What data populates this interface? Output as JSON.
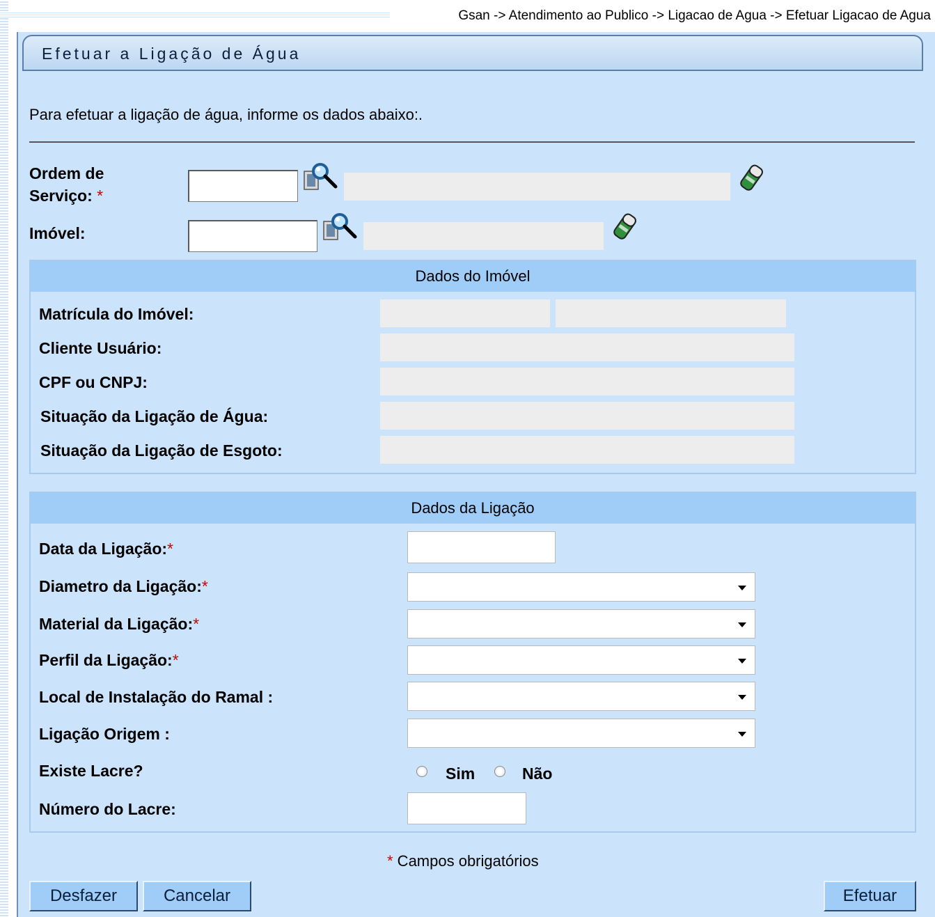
{
  "breadcrumb": "Gsan -> Atendimento ao Publico -> Ligacao de Agua -> Efetuar Ligacao de Agua",
  "title": "Efetuar a Ligação de Água",
  "intro": "Para efetuar a ligação de água, informe os dados abaixo:.",
  "search": {
    "ordem_label_1": "Ordem de",
    "ordem_label_2": "Serviço:",
    "ordem_value": "",
    "imovel_label": "Imóvel:",
    "imovel_value": "",
    "required_mark": "*"
  },
  "dados_imovel": {
    "header": "Dados do Imóvel",
    "matricula_label": "Matrícula do Imóvel:",
    "cliente_label": "Cliente Usuário:",
    "cpf_label": "CPF ou CNPJ:",
    "sit_agua_label": "Situação da Ligação de Água:",
    "sit_esgoto_label": "Situação da Ligação de Esgoto:"
  },
  "dados_ligacao": {
    "header": "Dados da Ligação",
    "data_label": "Data da Ligação:",
    "diametro_label": "Diametro da Ligação:",
    "material_label": "Material da Ligação:",
    "perfil_label": "Perfil da Ligação:",
    "local_label": "Local de Instalação do Ramal :",
    "origem_label": "Ligação Origem :",
    "lacre_label": "Existe Lacre?",
    "lacre_sim": "Sim",
    "lacre_nao": "Não",
    "numero_lacre_label": "Número do Lacre:",
    "data_value": "",
    "diametro_value": "",
    "material_value": "",
    "perfil_value": "",
    "local_value": "",
    "origem_value": "",
    "numero_lacre_value": ""
  },
  "footnote": {
    "mark": "*",
    "text": " Campos obrigatórios"
  },
  "buttons": {
    "desfazer": "Desfazer",
    "cancelar": "Cancelar",
    "efetuar": "Efetuar"
  },
  "icons": {
    "search": "magnifier-icon",
    "clear": "eraser-icon"
  },
  "colors": {
    "panel_bg": "#cce4fb",
    "section_header": "#9fcdf7",
    "required": "#d40000"
  }
}
